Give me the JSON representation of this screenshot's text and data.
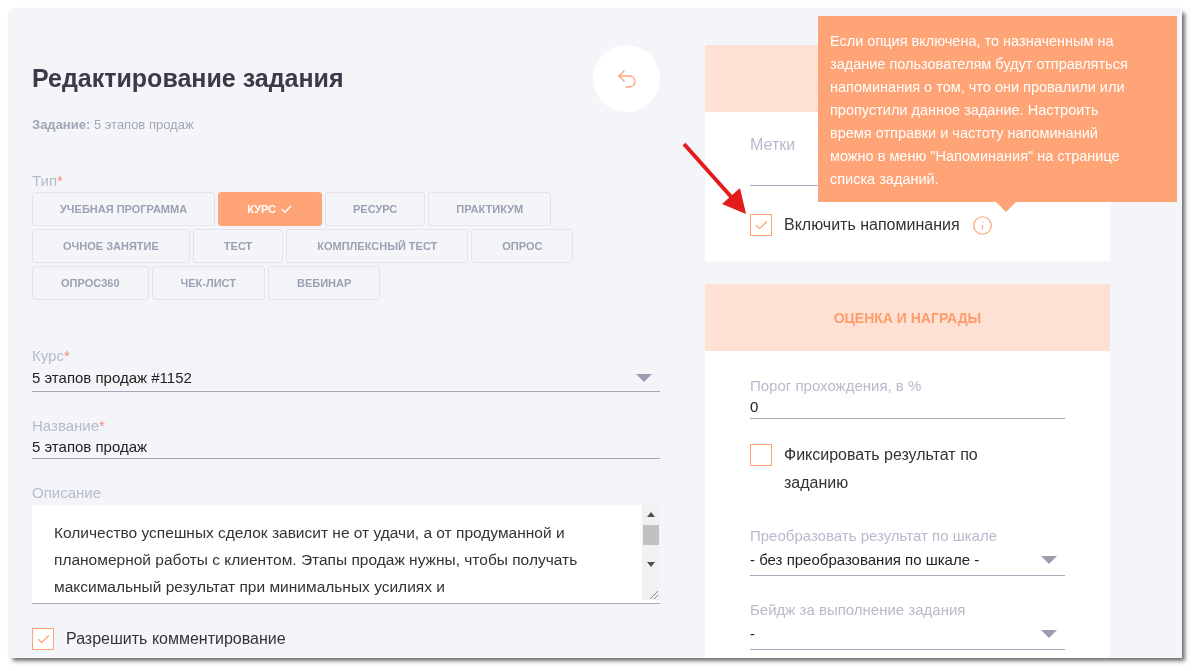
{
  "title": "Редактирование задания",
  "subtitle": "**Задание:** 5 этапов продаж",
  "type_field": {
    "label": "Тип",
    "required_mark": "*",
    "rows": [
      [
        {
          "label": "УЧЕБНАЯ ПРОГРАММА",
          "selected": false
        },
        {
          "label": "КУРС",
          "selected": true
        },
        {
          "label": "РЕСУРС",
          "selected": false
        },
        {
          "label": "ПРАКТИКУМ",
          "selected": false
        }
      ],
      [
        {
          "label": "ОЧНОЕ ЗАНЯТИЕ",
          "selected": false
        },
        {
          "label": "ТЕСТ",
          "selected": false
        },
        {
          "label": "КОМПЛЕКСНЫЙ ТЕСТ",
          "selected": false
        },
        {
          "label": "ОПРОС",
          "selected": false
        }
      ],
      [
        {
          "label": "ОПРОС360",
          "selected": false
        },
        {
          "label": "ЧЕК-ЛИСТ",
          "selected": false
        },
        {
          "label": "ВЕБИНАР",
          "selected": false
        }
      ]
    ]
  },
  "course": {
    "label": "Курс",
    "required_mark": "*",
    "value": "5 этапов продаж #1152"
  },
  "name": {
    "label": "Название",
    "required_mark": "*",
    "value": "5 этапов продаж"
  },
  "description": {
    "label": "Описание",
    "value": "Количество успешных сделок зависит не от удачи, а от продуманной и планомерной работы с клиентом. Этапы продаж нужны, чтобы получать максимальный результат при минимальных усилиях и"
  },
  "allow_comments": {
    "label": "Разрешить комментирование",
    "checked": true
  },
  "settings_panel": {
    "tags": {
      "label": "Метки"
    },
    "reminders": {
      "label": "Включить напоминания",
      "checked": true
    },
    "tooltip": "Если опция включена, то назначенным на задание пользователям будут отправляться напоминания о том, что они провалили или пропустили данное задание. Настроить время отправки и частоту напоминаний можно в меню \"Напоминания\" на странице списка заданий."
  },
  "grading_panel": {
    "title": "ОЦЕНКА И НАГРАДЫ",
    "threshold": {
      "label": "Порог прохождения, в %",
      "value": "0"
    },
    "fix_result": {
      "label": "Фиксировать результат по заданию",
      "checked": false
    },
    "scale": {
      "label": "Преобразовать результат по шкале",
      "value": "- без преобразования по шкале -"
    },
    "badge": {
      "label": "Бейдж за выполнение задания",
      "value": "-"
    }
  }
}
